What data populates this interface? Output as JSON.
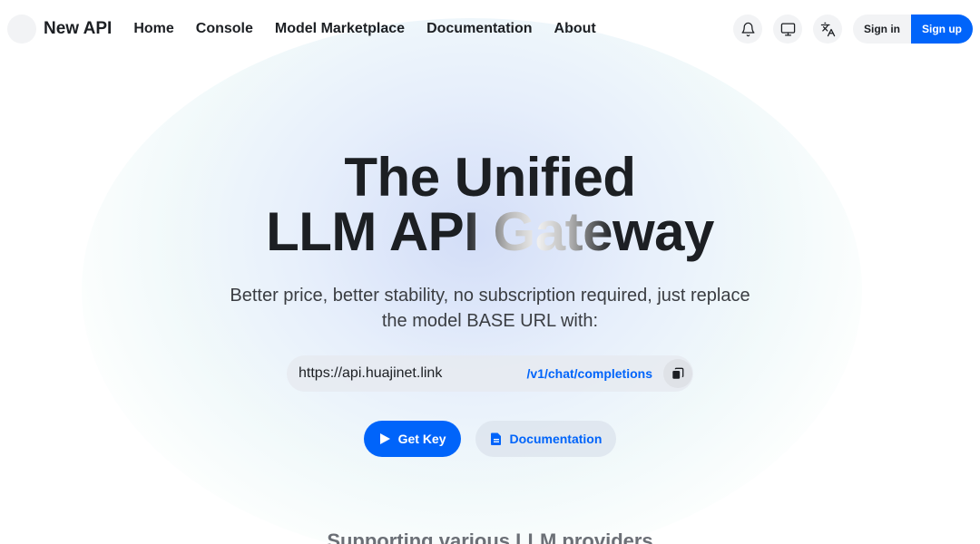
{
  "nav": {
    "brand": "New API",
    "links": [
      "Home",
      "Console",
      "Model Marketplace",
      "Documentation",
      "About"
    ],
    "icons": [
      "bell-icon",
      "monitor-icon",
      "translate-icon"
    ],
    "signin_label": "Sign in",
    "signup_label": "Sign up"
  },
  "hero": {
    "title_line1": "The Unified",
    "title_line2_a": "LLM AP",
    "title_line2_b": "I Gate",
    "title_line2_c": "way",
    "subtitle": "Better price, better stability, no subscription required, just replace the model BASE URL with:",
    "base_url": "https://api.huajinet.link",
    "endpoint": "/v1/chat/completions",
    "get_key_label": "Get Key",
    "docs_label": "Documentation"
  },
  "providers_heading": "Supporting various LLM providers",
  "colors": {
    "primary": "#0064fa",
    "text": "#1c1f23",
    "surface": "#f2f3f5"
  }
}
